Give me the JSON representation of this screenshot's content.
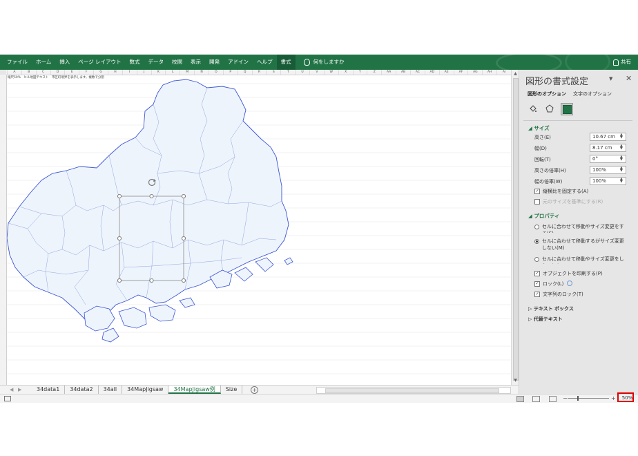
{
  "ribbon": {
    "tabs": [
      "ファイル",
      "ホーム",
      "挿入",
      "ページ レイアウト",
      "数式",
      "データ",
      "校閲",
      "表示",
      "開発",
      "アドイン",
      "ヘルプ",
      "書式"
    ],
    "active_tab": "書式",
    "tell_me": "何をしますか",
    "share": "共有",
    "color": "#217346"
  },
  "sheet": {
    "note": "縮尺50%　ヒル地図テキスト　市区町境界を表示します。複数で分割",
    "col_letters": [
      "A",
      "B",
      "C",
      "D",
      "E",
      "F",
      "G",
      "H",
      "I",
      "J",
      "K",
      "L",
      "M",
      "N",
      "O",
      "P",
      "Q",
      "R",
      "S",
      "T",
      "U",
      "V",
      "W",
      "X",
      "Y",
      "Z",
      "AA",
      "AB",
      "AC",
      "AD",
      "AE",
      "AF",
      "AG",
      "AH",
      "AI"
    ]
  },
  "sheet_tabs": {
    "tabs": [
      "34data1",
      "34data2",
      "34all",
      "34MapJigsaw",
      "34MapJigsaw例",
      "Size"
    ],
    "active": "34MapJigsaw例",
    "add": "+"
  },
  "status": {
    "zoom": "50%",
    "zoom_minus": "−",
    "zoom_plus": "+"
  },
  "pane": {
    "title": "図形の書式設定",
    "shape_options": "図形のオプション",
    "text_options": "文字のオプション",
    "size_section": "サイズ",
    "fields": [
      {
        "label": "高さ(E)",
        "value": "10.67 cm"
      },
      {
        "label": "幅(D)",
        "value": "8.17 cm"
      },
      {
        "label": "回転(T)",
        "value": "0°"
      },
      {
        "label": "高さの倍率(H)",
        "value": "100%"
      },
      {
        "label": "幅の倍率(W)",
        "value": "100%"
      }
    ],
    "lock_aspect": "縦横比を固定する(A)",
    "relative_original": "元のサイズを基準にする(R)",
    "props_section": "プロパティ",
    "radio1": "セルに合わせて移動やサイズ変更をする(S)",
    "radio2": "セルに合わせて移動するがサイズ変更しない(M)",
    "radio3": "セルに合わせて移動やサイズ変更をしない(D)",
    "print_object": "オブジェクトを印刷する(P)",
    "lock": "ロック(L)",
    "lock_text": "文字列のロック(T)",
    "textbox_section": "テキスト ボックス",
    "alt_text_section": "代替テキスト"
  }
}
